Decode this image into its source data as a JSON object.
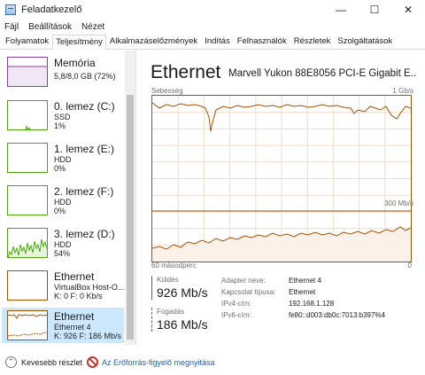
{
  "window": {
    "title": "Feladatkezelő",
    "minimize": "—",
    "maximize": "☐",
    "close": "✕"
  },
  "menu": [
    "Fájl",
    "Beállítások",
    "Nézet"
  ],
  "tabs": [
    {
      "label": "Folyamatok",
      "active": false
    },
    {
      "label": "Teljesítmény",
      "active": true
    },
    {
      "label": "Alkalmazáselőzmények",
      "active": false
    },
    {
      "label": "Indítás",
      "active": false
    },
    {
      "label": "Felhasználók",
      "active": false
    },
    {
      "label": "Részletek",
      "active": false
    },
    {
      "label": "Szolgáltatások",
      "active": false
    }
  ],
  "sidebar": {
    "items": [
      {
        "title": "Memória",
        "lines": [
          "5,8/8,0 GB (72%)"
        ],
        "color": "#8b3fa8"
      },
      {
        "title": "0. lemez (C:)",
        "lines": [
          "SSD",
          "1%"
        ],
        "color": "#4da60c"
      },
      {
        "title": "1. lemez (E:)",
        "lines": [
          "HDD",
          "0%"
        ],
        "color": "#4da60c"
      },
      {
        "title": "2. lemez (F:)",
        "lines": [
          "HDD",
          "0%"
        ],
        "color": "#4da60c"
      },
      {
        "title": "3. lemez (D:)",
        "lines": [
          "HDD",
          "54%"
        ],
        "color": "#4da60c"
      },
      {
        "title": "Ethernet",
        "lines": [
          "VirtualBox Host-O...",
          "K: 0 F: 0 Kb/s"
        ],
        "color": "#a74f01"
      },
      {
        "title": "Ethernet",
        "lines": [
          "Ethernet 4",
          "K: 926 F: 186 Mb/s"
        ],
        "color": "#a74f01",
        "selected": true
      }
    ]
  },
  "main": {
    "title": "Ethernet",
    "adapter": "Marvell Yukon 88E8056 PCI-E Gigabit E...",
    "speed_label": "Sebesség",
    "max_label": "1 Gb/s",
    "mid_label": "300 Mb/s",
    "time_label": "60 másodperc",
    "zero_label": "0",
    "send_label": "Küldés",
    "send_value": "926 Mb/s",
    "recv_label": "Fogadás",
    "recv_value": "186 Mb/s",
    "info": [
      {
        "label": "Adapter neve:",
        "value": "Ethernet 4"
      },
      {
        "label": "Kapcsolat típusa:",
        "value": "Ethernet"
      },
      {
        "label": "IPv4-cím:",
        "value": "192.168.1.128"
      },
      {
        "label": "IPv6-cím:",
        "value": "fe80::d003:db0c:7013:b397%4"
      }
    ]
  },
  "footer": {
    "less_icon": "chevron-up-icon",
    "less_label": "Kevesebb részlet",
    "monitor_icon": "resource-monitor-icon",
    "monitor_label": "Az Erőforrás-figyelő megnyitása"
  },
  "colors": {
    "accent": "#a74f01",
    "selection": "#cce8ff"
  }
}
